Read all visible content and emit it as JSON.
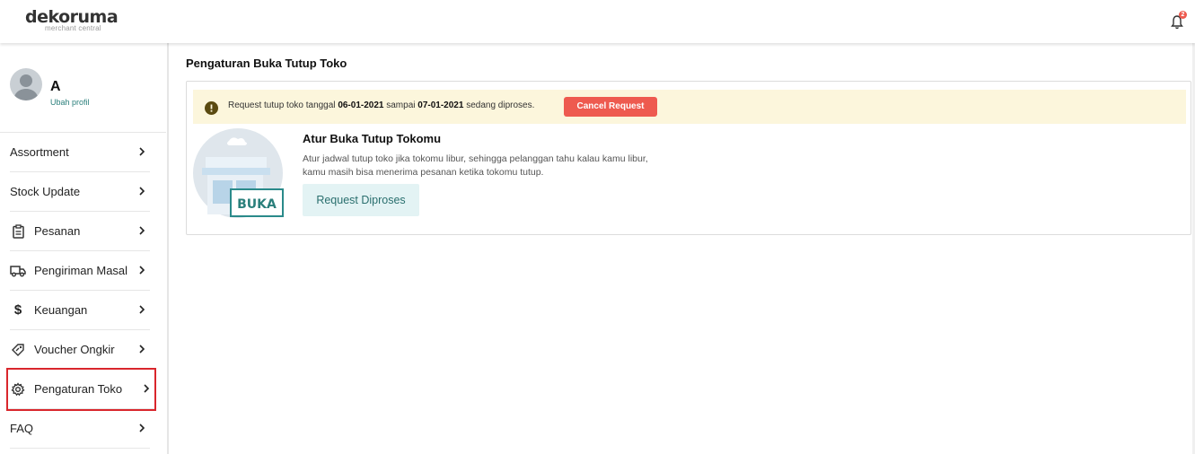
{
  "brand": {
    "name": "dekoruma",
    "sub": "merchant central"
  },
  "notifications": {
    "count": "2"
  },
  "profile": {
    "name": "A",
    "link": "Ubah profil"
  },
  "sidebar": {
    "items": [
      {
        "label": "Assortment",
        "icon": "none"
      },
      {
        "label": "Stock Update",
        "icon": "none"
      },
      {
        "label": "Pesanan",
        "icon": "clipboard-icon"
      },
      {
        "label": "Pengiriman Masal",
        "icon": "truck-icon"
      },
      {
        "label": "Keuangan",
        "icon": "dollar-icon"
      },
      {
        "label": "Voucher Ongkir",
        "icon": "voucher-tag-icon"
      },
      {
        "label": "Pengaturan Toko",
        "icon": "gear-icon",
        "active": true
      },
      {
        "label": "FAQ",
        "icon": "none"
      }
    ]
  },
  "main": {
    "title": "Pengaturan Buka Tutup Toko",
    "alert": {
      "prefix": "Request tutup toko tanggal ",
      "start_date": "06-01-2021",
      "middle": " sampai ",
      "end_date": "07-01-2021",
      "suffix": " sedang diproses.",
      "cancel_label": "Cancel Request"
    },
    "info": {
      "title": "Atur Buka Tutup Tokomu",
      "desc_line1": "Atur jadwal tutup toko jika tokomu libur, sehingga pelanggan tahu kalau kamu libur,",
      "desc_line2": "kamu masih bisa menerima pesanan ketika tokomu tutup.",
      "button_label": "Request Diproses",
      "sign_label": "BUKA"
    }
  },
  "colors": {
    "accent": "#ee5a4f",
    "teal": "#2a7f7b",
    "alert_bg": "#fcf6dc",
    "active_outline": "#d9262c"
  }
}
